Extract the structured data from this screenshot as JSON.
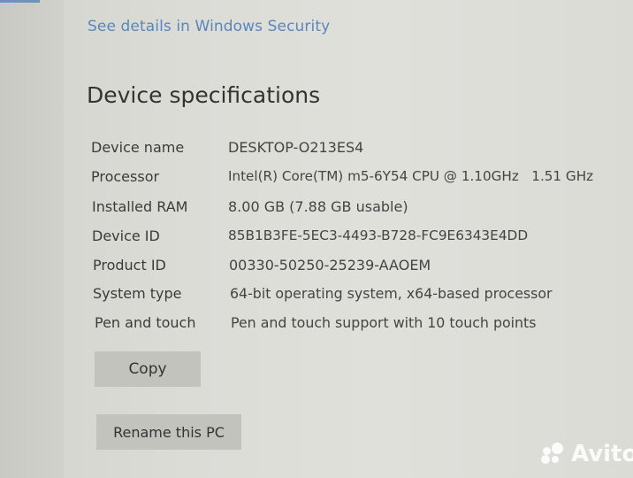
{
  "security_link": "See details in Windows Security",
  "section_title": "Device specifications",
  "specs": [
    {
      "label": "Device name",
      "value": "DESKTOP-O213ES4"
    },
    {
      "label": "Processor",
      "value": "Intel(R) Core(TM) m5-6Y54 CPU @ 1.10GHz   1.51 GHz"
    },
    {
      "label": "Installed RAM",
      "value": "8.00 GB (7.88 GB usable)"
    },
    {
      "label": "Device ID",
      "value": "85B1B3FE-5EC3-4493-B728-FC9E6343E4DD"
    },
    {
      "label": "Product ID",
      "value": "00330-50250-25239-AAOEM"
    },
    {
      "label": "System type",
      "value": "64-bit operating system, x64-based processor"
    },
    {
      "label": "Pen and touch",
      "value": "Pen and touch support with 10 touch points"
    }
  ],
  "buttons": {
    "copy": "Copy",
    "rename": "Rename this PC"
  },
  "watermark": {
    "icon": "avito-logo-icon",
    "text": "Avito"
  }
}
